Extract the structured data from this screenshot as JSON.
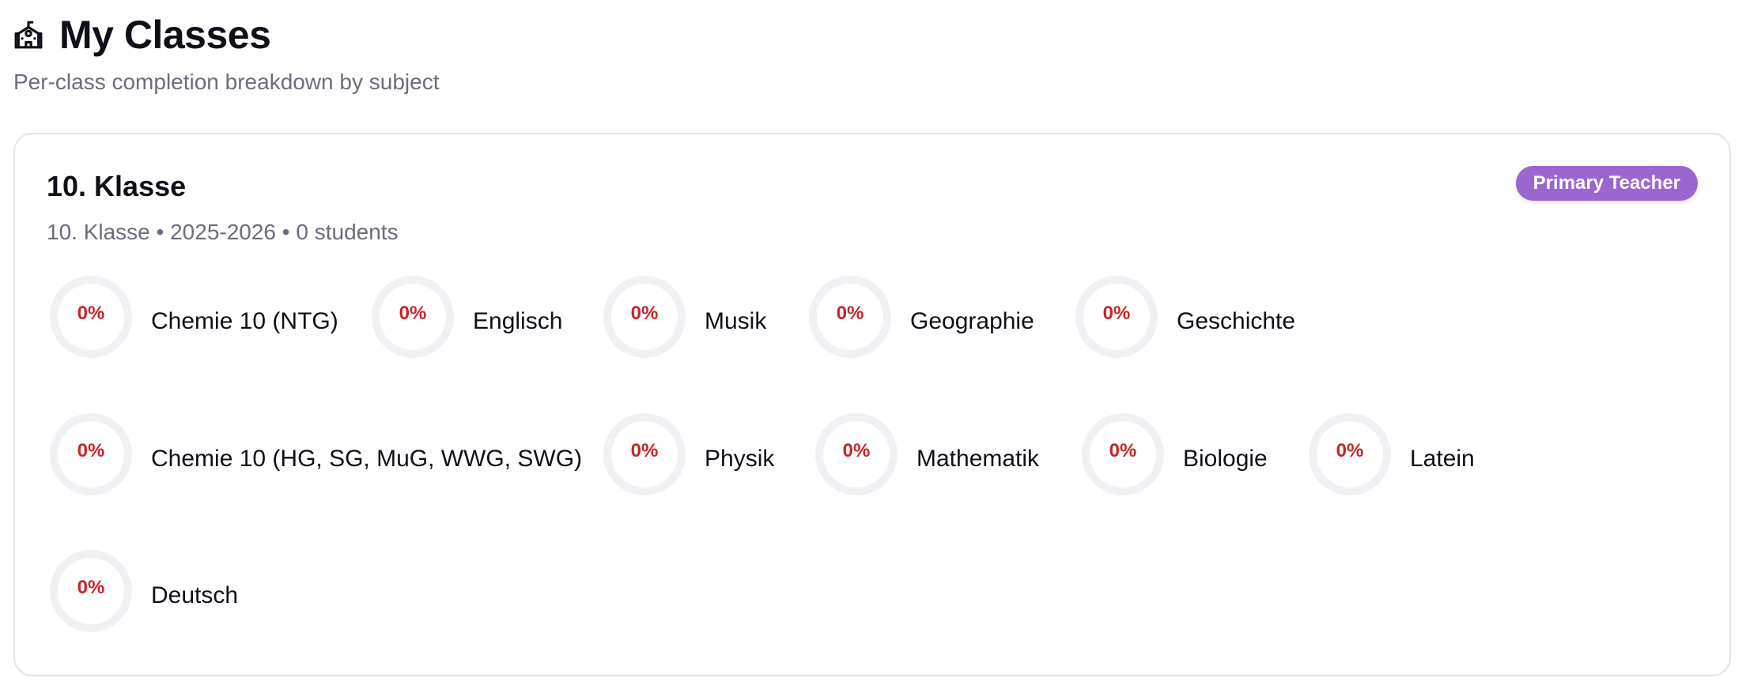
{
  "page": {
    "icon": "school-icon",
    "title": "My Classes",
    "subtitle": "Per-class completion breakdown by subject"
  },
  "class": {
    "name": "10. Klasse",
    "meta": "10. Klasse • 2025-2026 • 0 students",
    "badge": "Primary Teacher"
  },
  "colors": {
    "badge": "#9b66cf",
    "ring_track": "#f1f1f5",
    "percent_text": "#c4262a"
  },
  "subjects": [
    {
      "name": "Chemie 10 (NTG)",
      "percent": "0%",
      "completion": 0
    },
    {
      "name": "Englisch",
      "percent": "0%",
      "completion": 0
    },
    {
      "name": "Musik",
      "percent": "0%",
      "completion": 0
    },
    {
      "name": "Geographie",
      "percent": "0%",
      "completion": 0
    },
    {
      "name": "Geschichte",
      "percent": "0%",
      "completion": 0
    },
    {
      "name": "Chemie 10 (HG, SG, MuG, WWG, SWG)",
      "percent": "0%",
      "completion": 0
    },
    {
      "name": "Physik",
      "percent": "0%",
      "completion": 0
    },
    {
      "name": "Mathematik",
      "percent": "0%",
      "completion": 0
    },
    {
      "name": "Biologie",
      "percent": "0%",
      "completion": 0
    },
    {
      "name": "Latein",
      "percent": "0%",
      "completion": 0
    },
    {
      "name": "Deutsch",
      "percent": "0%",
      "completion": 0
    }
  ]
}
